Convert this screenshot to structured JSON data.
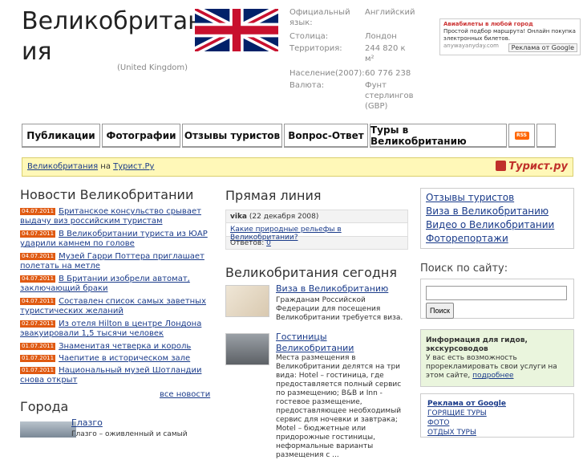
{
  "header": {
    "title": "Великобритания",
    "subtitle": "(United Kingdom)"
  },
  "facts": [
    {
      "key": "Официальный\nязык:",
      "value": "Английский"
    },
    {
      "key": "Столица:",
      "value": "Лондон"
    },
    {
      "key": "Территория:",
      "value": "244 820 к\nм²"
    },
    {
      "key": "Население(2007):",
      "value": "60 776 238"
    },
    {
      "key": "Валюта:",
      "value": "Фунт\nстерлингов\n(GBP)"
    }
  ],
  "ad_top": {
    "heading": "Авиабилеты в любой город",
    "text": "Простой подбор маршрута! Онлайн покупка электронных билетов.",
    "source": "anywayanyday.com",
    "badge": "Реклама от Google"
  },
  "menu": {
    "tabs": [
      "Публикации",
      "Фотографии",
      "Отзывы туристов",
      "Вопрос-Ответ",
      "Туры в Великобританию"
    ],
    "rss": "RSS"
  },
  "breadcrumb": {
    "link1": "Великобритания",
    "sep": "на",
    "link2": "Турист.Ру",
    "logo": "Турист.ру"
  },
  "news": {
    "title": "Новости Великобритании",
    "items": [
      {
        "date": "04.07.2011",
        "text": "Британское консульство срывает выдачу виз российским туристам"
      },
      {
        "date": "04.07.2011",
        "text": "В Великобритании туриста из ЮАР ударили камнем по голове"
      },
      {
        "date": "04.07.2011",
        "text": "Музей Гарри Поттера приглашает полетать на метле"
      },
      {
        "date": "04.07.2011",
        "text": "В Британии изобрели автомат, заключающий браки"
      },
      {
        "date": "04.07.2011",
        "text": "Составлен список самых заветных туристических желаний"
      },
      {
        "date": "02.07.2011",
        "text": "Из отеля Hilton в центре Лондона эвакуировали 1,5 тысячи человек"
      },
      {
        "date": "01.07.2011",
        "text": "Знаменитая четверка и король"
      },
      {
        "date": "01.07.2011",
        "text": "Чаепитие в историческом зале"
      },
      {
        "date": "01.07.2011",
        "text": "Национальный музей Шотландии снова открыт"
      }
    ],
    "all_link": "все новости"
  },
  "cities": {
    "title": "Города",
    "first_name": "Глазго",
    "first_desc": "Глазго – оживленный и самый"
  },
  "live": {
    "title": "Прямая линия",
    "user": "vika",
    "date": "(22 декабря 2008)",
    "question": "Какие природные рельефы в Великобритании?",
    "answers_label": "Ответов:",
    "answers_count": "0"
  },
  "today": {
    "title": "Великобритания сегодня",
    "items": [
      {
        "title": "Виза в Великобританию",
        "desc": "Гражданам Российской Федерации для посещения Великобритании требуется виза."
      },
      {
        "title": "Гостиницы Великобритании",
        "desc": "Места размещения в Великобритании делятся на три вида: Hotel – гостиница, где предоставляется полный сервис по размещению; B&B и Inn - гостевое размещение, предоставляющее необходимый сервис для ночевки и завтрака; Motel – бюджетные или придорожные гостиницы, неформальные варианты размещения с ..."
      }
    ]
  },
  "sidebar": {
    "links": [
      "Отзывы туристов",
      "Виза в Великобританию",
      "Видео о Великобритании",
      "Фоторепортажи"
    ],
    "search_title": "Поиск по сайту:",
    "search_button": "Поиск",
    "guide_title": "Информация для гидов, экскурсоводов",
    "guide_text": "У вас есть возможность прорекламировать свои услуги на этом сайте,",
    "guide_link": "подробнее",
    "ad_title": "Реклама от Google",
    "ad_links": [
      "ГОРЯЩИЕ ТУРЫ",
      "ФОТО",
      "ОТДЫХ ТУРЫ"
    ]
  },
  "colors": {
    "date_badge": "#e05a12",
    "breadcrumb_bg": "#fff8b8",
    "link": "#1a3b8a",
    "guide_bg": "#eaf5dd"
  }
}
